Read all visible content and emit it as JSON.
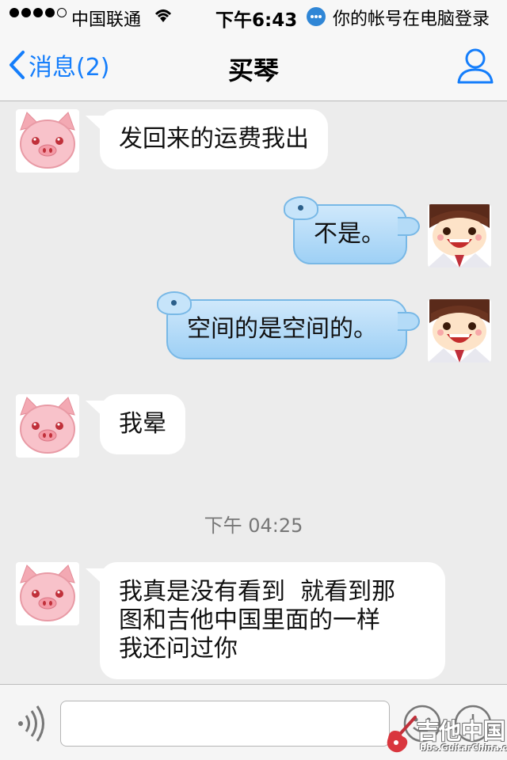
{
  "status_bar": {
    "carrier": "中国联通",
    "time": "下午6:43",
    "notice": "你的帐号在电脑登录"
  },
  "nav": {
    "back_label": "消息(2)",
    "title": "买琴"
  },
  "messages": [
    {
      "side": "left",
      "text": "发回来的运费我出"
    },
    {
      "side": "right",
      "text": "不是。"
    },
    {
      "side": "right",
      "text": "空间的是空间的。"
    },
    {
      "side": "left",
      "text": "我晕"
    },
    {
      "side": "left",
      "lines": [
        "我真是没有看到  就看到那",
        "图和吉他中国里面的一样",
        "我还问过你"
      ]
    }
  ],
  "timestamp": "下午 04:25",
  "input": {
    "value": "",
    "placeholder": ""
  },
  "watermark": {
    "title": "吉他中国",
    "url": "bbs.GuitarChina.com"
  },
  "colors": {
    "accent": "#157efb",
    "background": "#ececec",
    "bubble_left": "#ffffff",
    "bubble_right": "#aed8f7"
  },
  "icons": [
    "back-chevron-icon",
    "profile-icon",
    "voice-icon",
    "emoji-icon",
    "plus-icon",
    "wifi-icon",
    "qq-icon"
  ]
}
